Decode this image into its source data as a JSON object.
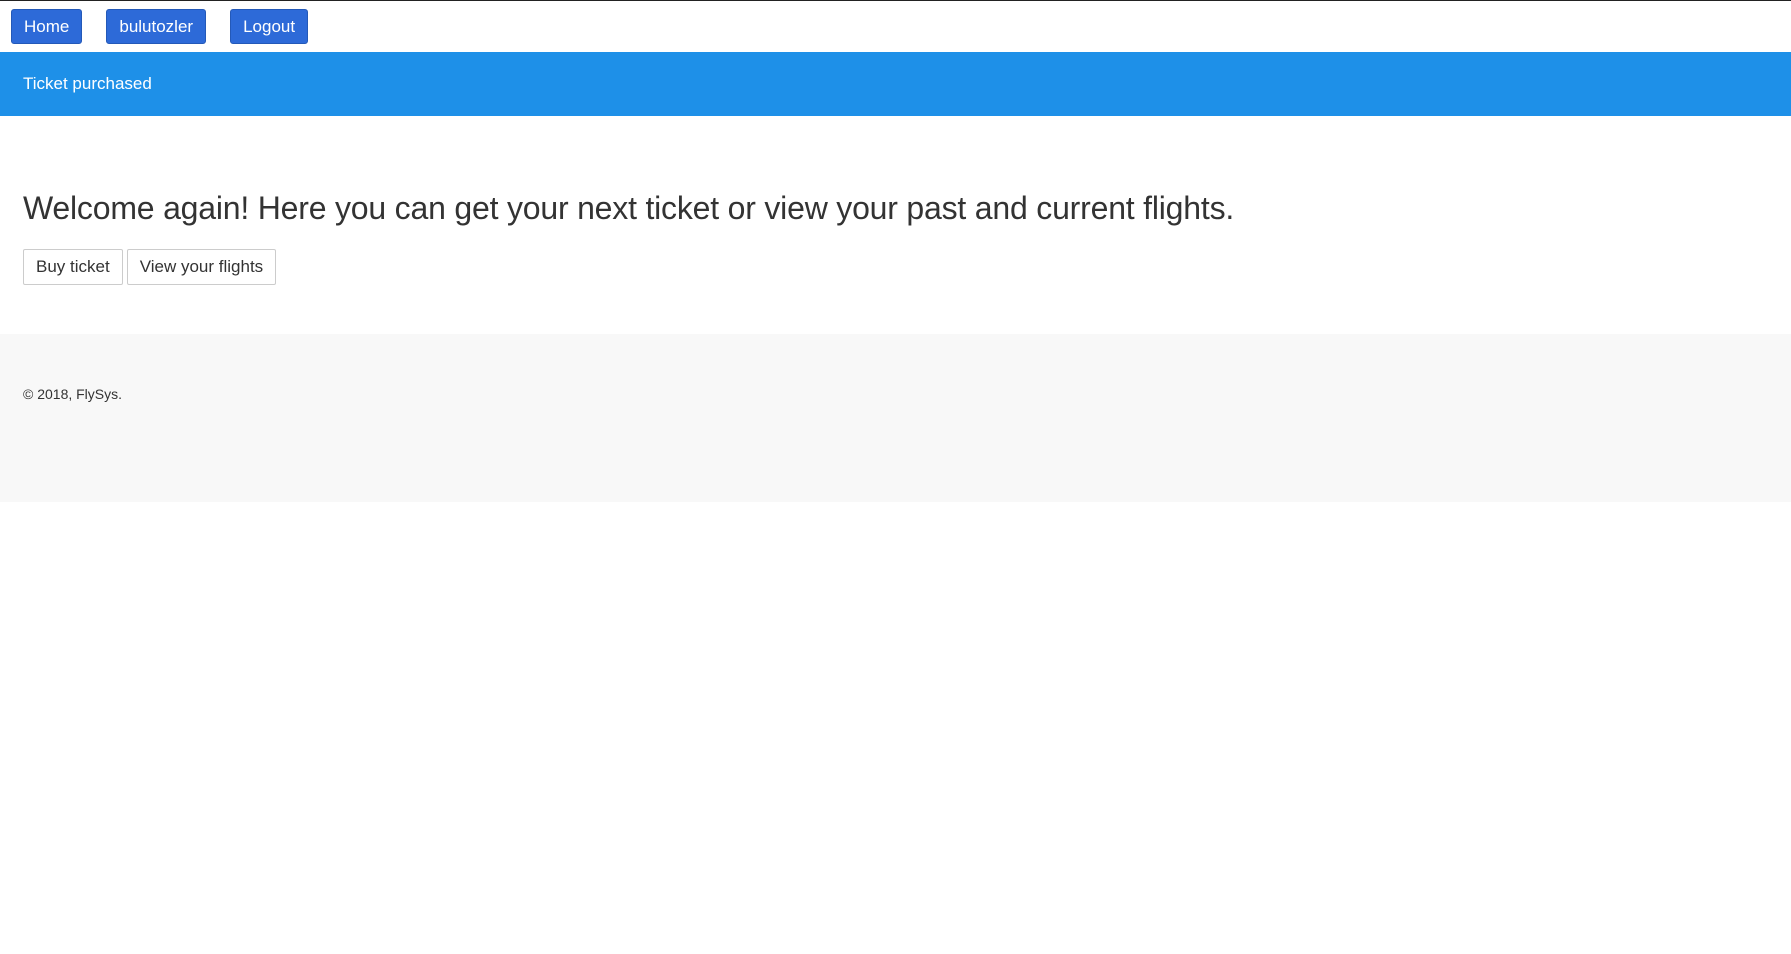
{
  "nav": {
    "home_label": "Home",
    "user_label": "bulutozler",
    "logout_label": "Logout"
  },
  "flash": {
    "message": "Ticket purchased"
  },
  "main": {
    "welcome_text": "Welcome again! Here you can get your next ticket or view your past and current flights.",
    "buy_ticket_label": "Buy ticket",
    "view_flights_label": "View your flights"
  },
  "footer": {
    "copyright": "© 2018, FlySys."
  },
  "colors": {
    "nav_button": "#2d6ad8",
    "flash_banner": "#1e90e8",
    "footer_bg": "#f8f8f8"
  }
}
